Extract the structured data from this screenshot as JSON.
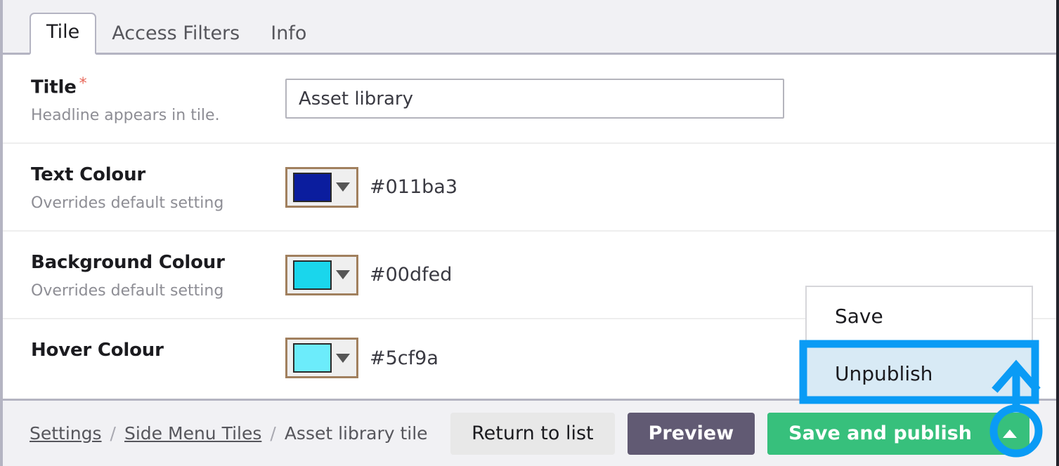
{
  "tabs": [
    {
      "label": "Tile",
      "active": true
    },
    {
      "label": "Access Filters",
      "active": false
    },
    {
      "label": "Info",
      "active": false
    }
  ],
  "form": {
    "rows": [
      {
        "label": "Title",
        "required": "*",
        "hint": "Headline appears in tile.",
        "type": "text",
        "value": "Asset library"
      },
      {
        "label": "Text Colour",
        "hint": "Overrides default setting",
        "type": "colour",
        "hex": "#011ba3",
        "swatch_color": "#0b1d9e"
      },
      {
        "label": "Background Colour",
        "hint": "Overrides default setting",
        "type": "colour",
        "hex": "#00dfed",
        "swatch_color": "#1ad6ec"
      },
      {
        "label": "Hover Colour",
        "hint": "",
        "type": "colour",
        "hex": "#5cf9a",
        "swatch_color": "#6cecfb"
      }
    ]
  },
  "dropdown": {
    "items": [
      {
        "label": "Save",
        "highlighted": false
      },
      {
        "label": "Unpublish",
        "highlighted": true
      }
    ]
  },
  "footer": {
    "breadcrumb": {
      "item1": "Settings",
      "separator1": "/",
      "item2": "Side Menu Tiles",
      "separator2": "/",
      "current": "Asset library tile"
    },
    "buttons": {
      "return": "Return to list",
      "preview": "Preview",
      "publish": "Save and publish"
    }
  },
  "colors": {
    "accent_green": "#37c07c",
    "preview_purple": "#615a73",
    "annotation_blue": "#0a9bf5",
    "highlight_blue": "#d8eaf5",
    "required_red": "#e8685a",
    "swatch_border": "#a1805e"
  }
}
